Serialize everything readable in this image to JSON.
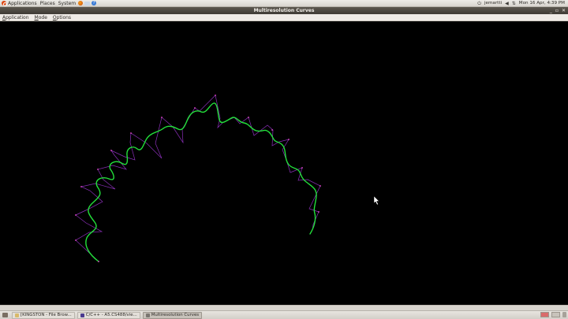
{
  "top_panel": {
    "menus": [
      "Applications",
      "Places",
      "System"
    ],
    "user": "jemartti",
    "clock": "Mon 16 Apr,  4:39 PM",
    "launchers": [
      "firefox-icon",
      "mail-icon",
      "help-icon"
    ],
    "tray_icons": [
      "power-icon",
      "volume-icon",
      "network-icon"
    ]
  },
  "window": {
    "title": "Multiresolution Curves",
    "controls": [
      "_",
      "▫",
      "✕"
    ]
  },
  "menubar": {
    "items": [
      "Application",
      "Mode",
      "Options"
    ]
  },
  "canvas": {
    "background": "#000000",
    "curve_color": "#22e03a",
    "control_polygon_color": "#8a2fb8"
  },
  "taskbar": {
    "tasks": [
      {
        "label": "[KINGSTON - File Brow...",
        "icon_color": "#d8b96a",
        "active": false
      },
      {
        "label": "C/C++ - A5.CS488/vie...",
        "icon_color": "#4b3b8f",
        "active": false
      },
      {
        "label": "Multiresolution Curves",
        "icon_color": "#7a7670",
        "active": true
      }
    ]
  }
}
